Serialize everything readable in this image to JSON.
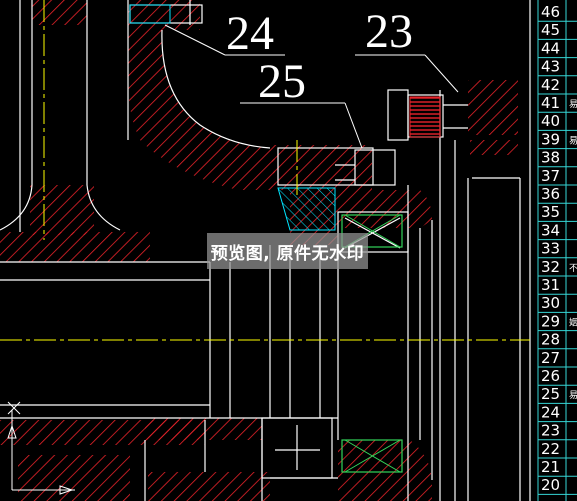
{
  "callouts": {
    "c24": "24",
    "c25": "25",
    "c23": "23"
  },
  "watermark": "预览图, 原件无水印",
  "table_rows": [
    "46",
    "45",
    "44",
    "43",
    "42",
    "41",
    "40",
    "39",
    "38",
    "37",
    "36",
    "35",
    "34",
    "33",
    "32",
    "31",
    "30",
    "29",
    "28",
    "27",
    "26",
    "25",
    "24",
    "23",
    "22",
    "21",
    "20"
  ],
  "side_marks": {
    "41": "易",
    "39": "易",
    "33": "",
    "32": "不",
    "29": "姻",
    "25": "易"
  },
  "colors": {
    "background": "#000000",
    "hatch": "#e8232a",
    "line": "#ffffff",
    "center": "#ffff00",
    "table": "#36d6d6",
    "cyan": "#00e5ff",
    "green": "#33d45a"
  }
}
